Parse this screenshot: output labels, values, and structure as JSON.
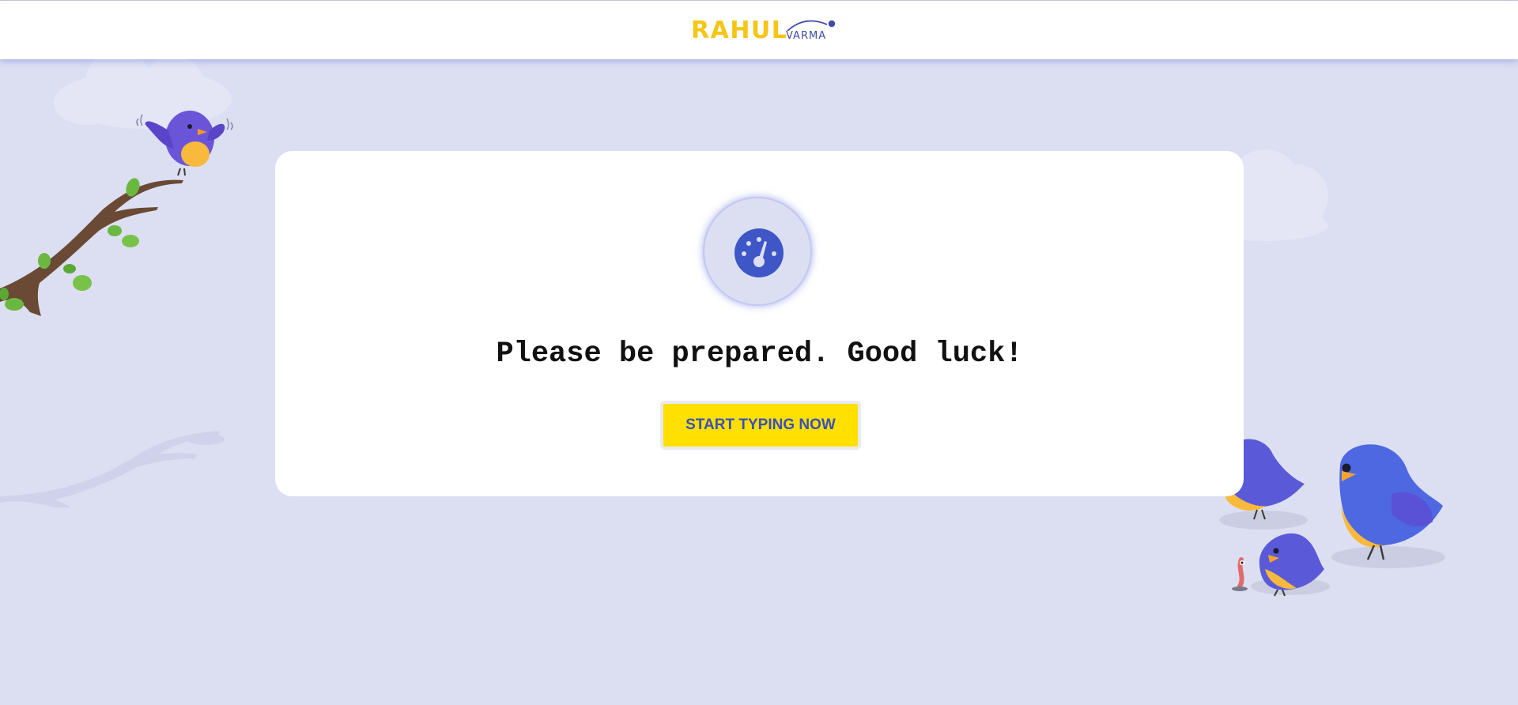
{
  "header": {
    "logo_main": "RAHUL",
    "logo_sub": "VARMA"
  },
  "card": {
    "icon": "speedometer-icon",
    "headline": "Please be prepared. Good luck!",
    "button_label": "START TYPING NOW"
  },
  "colors": {
    "background": "#dcdff2",
    "logo_yellow": "#f5c518",
    "accent_blue": "#3e56c6",
    "button_yellow": "#ffe000"
  }
}
